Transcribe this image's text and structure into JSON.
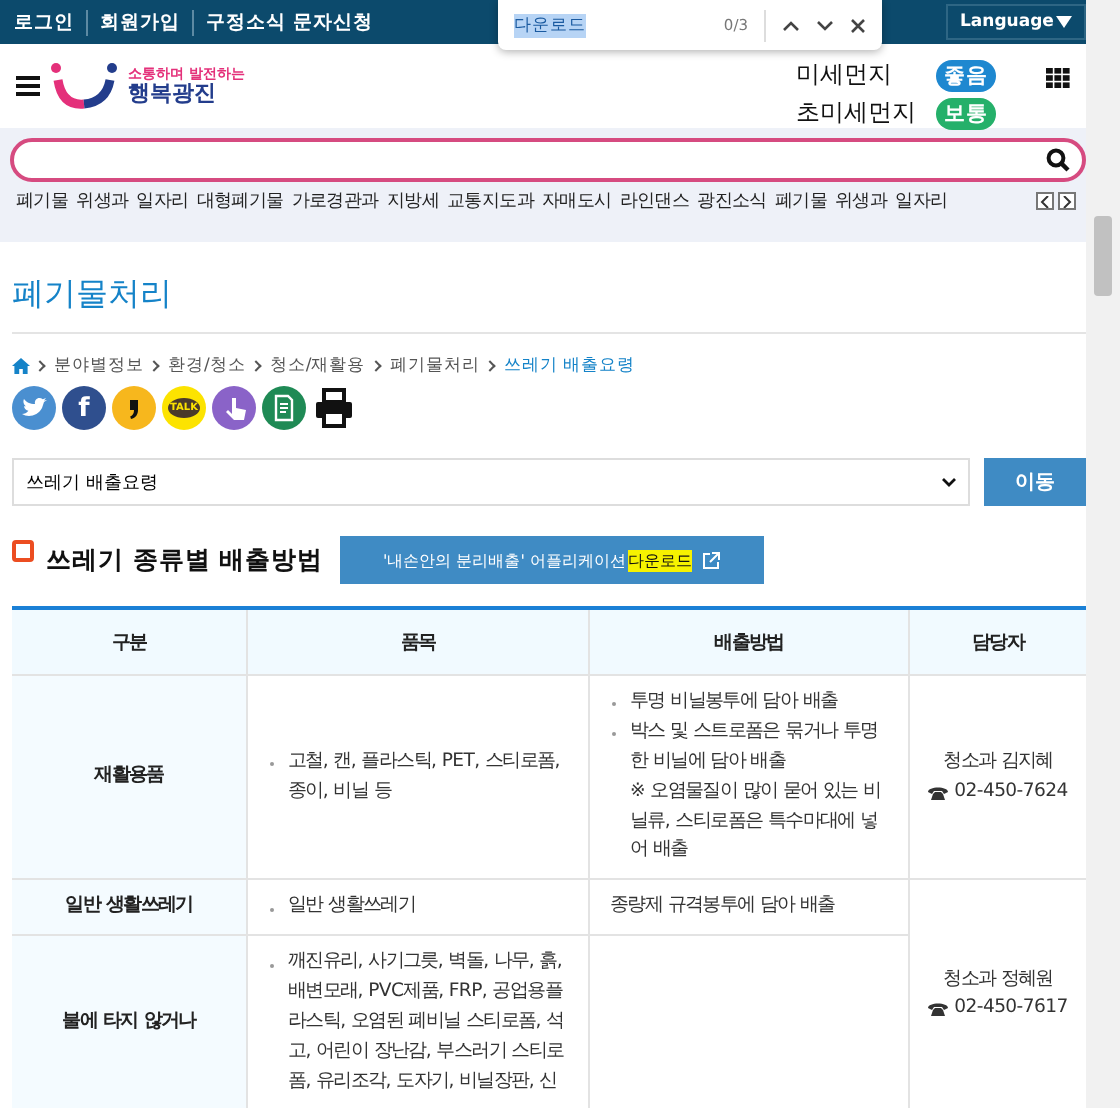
{
  "find_bar": {
    "query": "다운로드",
    "count": "0/3"
  },
  "top_bar": {
    "links": [
      "로그인",
      "회원가입",
      "구정소식 문자신청"
    ],
    "language": "Language"
  },
  "logo": {
    "tagline": "소통하며 발전하는",
    "name": "행복광진"
  },
  "air_quality": [
    {
      "label": "미세먼지",
      "status": "좋음",
      "color": "#1e88d0"
    },
    {
      "label": "초미세먼지",
      "status": "보통",
      "color": "#25b06a"
    }
  ],
  "nav_links": [
    "폐기물",
    "위생과",
    "일자리",
    "대형폐기물",
    "가로경관과",
    "지방세",
    "교통지도과",
    "자매도시",
    "라인댄스",
    "광진소식",
    "폐기물",
    "위생과",
    "일자리"
  ],
  "page_title": "폐기물처리",
  "breadcrumb": [
    {
      "text": "분야별정보",
      "current": false
    },
    {
      "text": "환경/청소",
      "current": false
    },
    {
      "text": "청소/재활용",
      "current": false
    },
    {
      "text": "폐기물처리",
      "current": false
    },
    {
      "text": "쓰레기 배출요령",
      "current": true
    }
  ],
  "share_buttons": [
    {
      "kind": "twitter"
    },
    {
      "kind": "facebook",
      "label": "f"
    },
    {
      "kind": "comma"
    },
    {
      "kind": "kakao",
      "label": "TALK"
    },
    {
      "kind": "touch"
    },
    {
      "kind": "document"
    },
    {
      "kind": "print"
    }
  ],
  "menu_select": {
    "value": "쓰레기 배출요령"
  },
  "go_button": "이동",
  "section": {
    "heading": "쓰레기 종류별 배출방법",
    "app_button": {
      "text": "'내손안의 분리배출' 어플리케이션 ",
      "highlight": "다운로드"
    }
  },
  "table": {
    "columns": [
      "구분",
      "품목",
      "배출방법",
      "담당자"
    ],
    "rows": [
      {
        "category": [
          "재활용품"
        ],
        "items": [
          "고철, 캔, 플라스틱, PET, 스티로폼, 종이, 비닐 등"
        ],
        "method": [
          {
            "kind": "bullet",
            "text": "투명 비닐봉투에 담아 배출"
          },
          {
            "kind": "bullet",
            "text": "박스 및 스트로폼은 묶거나 투명한 비닐에 담아 배출"
          },
          {
            "kind": "note",
            "text": "※ 오염물질이 많이 묻어 있는 비닐류, 스티로폼은 특수마대에 넣어 배출"
          }
        ],
        "contact": {
          "dept": "청소과 김지혜",
          "phone": "02-450-7624"
        }
      },
      {
        "category": [
          "일반 생활쓰레기"
        ],
        "items": [
          "일반 생활쓰레기"
        ],
        "method": [
          {
            "kind": "plain",
            "text": "종량제 규격봉투에 담아 배출"
          }
        ],
        "contact": {
          "dept": "청소과 정혜원",
          "phone": "02-450-7617"
        }
      },
      {
        "category": [
          "불에 타지 않거나"
        ],
        "items": [
          "깨진유리, 사기그릇, 벽돌, 나무, 흙, 배변모래, PVC제품,  FRP, 공업용플라스틱, 오염된 폐비닐 스티로폼, 석고, 어린이 장난감, 부스러기 스티로폼, 유리조각, 도자기, 비닐장판, 신"
        ],
        "method": []
      }
    ]
  }
}
